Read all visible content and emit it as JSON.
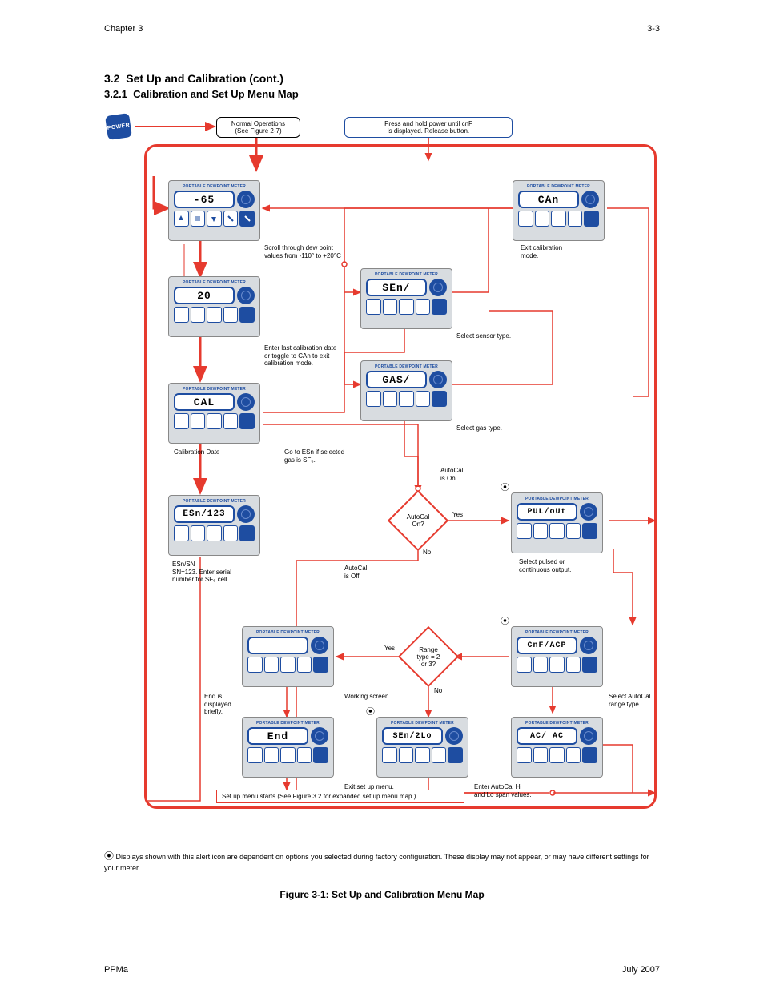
{
  "header": {
    "chapter": "Chapter 3",
    "page_top": "3-3",
    "section_num": "3.2",
    "section_title": "Set Up and Calibration (cont.)",
    "subsection_num": "3.2.1",
    "subsection_title": "Calibration and Set Up Menu Map"
  },
  "power": {
    "label": "POWER"
  },
  "boxes": {
    "normal_ops": "Normal Operations\n(See Figure 2-7)",
    "hold_power": "Press and hold power until cnF\nis displayed. Release button."
  },
  "devices": {
    "d1": {
      "lcd": "-65"
    },
    "d2": {
      "lcd": "20"
    },
    "d3": {
      "lcd": "CAL"
    },
    "d4": {
      "lcd": "ESn/123"
    },
    "d5": {
      "lcd": "CAn"
    },
    "d6": {
      "lcd": "SEn/"
    },
    "d7": {
      "lcd": "GAS/"
    },
    "d8": {
      "lcd": "PUL/oUt"
    },
    "d9": {
      "lcd": "CnF/ACP"
    },
    "d10": {
      "lcd": "AC/_AC"
    },
    "d11": {
      "lcd": "SEn/2Lo"
    },
    "d12": {
      "lcd": ""
    },
    "d13": {
      "lcd": "End"
    }
  },
  "labels": {
    "scroll_dp": "Scroll through dew point\nvalues from -110° to +20°C",
    "last_cal": "Enter last calibration date\nor toggle to CAn to exit\ncalibration mode.",
    "cal_date": "Calibration Date",
    "exit_cal": "Exit calibration\nmode.",
    "select_sensor": "Select sensor type.",
    "select_gas": "Select gas type.",
    "go_esn": "Go to ESn if selected\ngas is SF₆.",
    "esn_sn": "ESn/SN\nSN=123. Enter serial\nnumber for SF₆ cell.",
    "autocal_on": "AutoCal\nis On.",
    "autocal_off": "AutoCal\nis Off.",
    "select_output": "Select pulsed or\ncontinuous output.",
    "select_range": "Select AutoCal\nrange type.",
    "enter_span": "Enter AutoCal Hi\nand Lo span values.",
    "working_screen": "Working screen.",
    "end_display": "End is\ndisplayed\nbriefly.",
    "exit_setup": "Exit set up menu.",
    "yes": "Yes",
    "no": "No",
    "diamond1": "AutoCal\nOn?",
    "diamond2": "Range\ntype = 2\nor 3?"
  },
  "bottom_box": "Set up menu starts (See Figure 3.2 for expanded set up menu map.)",
  "footnote_symbol": "⚙",
  "footnote": "  Displays shown with this alert icon are dependent on options you selected during factory\nconfiguration. These display may not appear, or may have different settings for your meter.",
  "figure_caption": "Figure 3-1: Set Up and Calibration Menu Map",
  "footer": {
    "left": "PPMa",
    "right": "July 2007"
  }
}
